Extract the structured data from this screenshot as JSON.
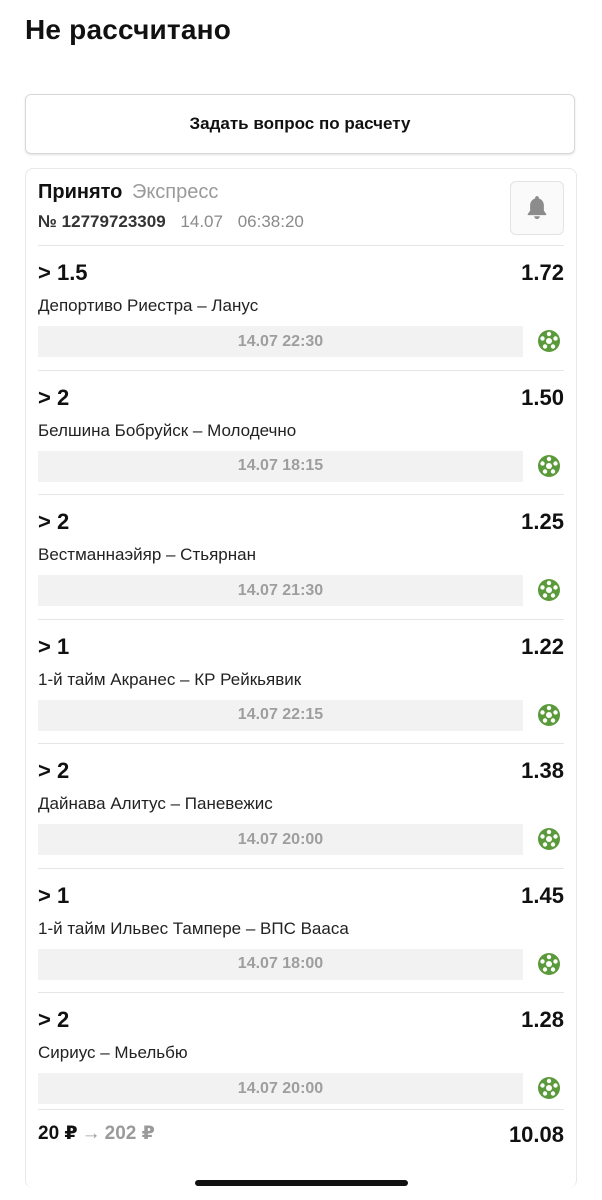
{
  "page": {
    "title": "Не рассчитано"
  },
  "actions": {
    "ask_question": "Задать вопрос по расчету"
  },
  "bet": {
    "status": "Принято",
    "type": "Экспресс",
    "number": "№ 12779723309",
    "date": "14.07",
    "time": "06:38:20",
    "events": [
      {
        "outcome": "> 1.5",
        "odds": "1.72",
        "match": "Депортиво Риестра – Ланус",
        "start": "14.07 22:30"
      },
      {
        "outcome": "> 2",
        "odds": "1.50",
        "match": "Белшина Бобруйск – Молодечно",
        "start": "14.07 18:15"
      },
      {
        "outcome": "> 2",
        "odds": "1.25",
        "match": "Вестманнаэйяр – Стьярнан",
        "start": "14.07 21:30"
      },
      {
        "outcome": "> 1",
        "odds": "1.22",
        "match": "1-й тайм Акранес – КР Рейкьявик",
        "start": "14.07 22:15"
      },
      {
        "outcome": "> 2",
        "odds": "1.38",
        "match": "Дайнава Алитус – Паневежис",
        "start": "14.07 20:00"
      },
      {
        "outcome": "> 1",
        "odds": "1.45",
        "match": "1-й тайм Ильвес Тампере – ВПС Вааса",
        "start": "14.07 18:00"
      },
      {
        "outcome": "> 2",
        "odds": "1.28",
        "match": "Сириус – Мьельбю",
        "start": "14.07 20:00"
      }
    ],
    "stake": "20 ₽",
    "arrow": "→",
    "payout": "202 ₽",
    "total_odds": "10.08"
  },
  "icons": {
    "bell": "bell-icon",
    "sport": "football-icon"
  },
  "colors": {
    "accent_green": "#5a9a3a",
    "muted": "#9a9a9a"
  }
}
